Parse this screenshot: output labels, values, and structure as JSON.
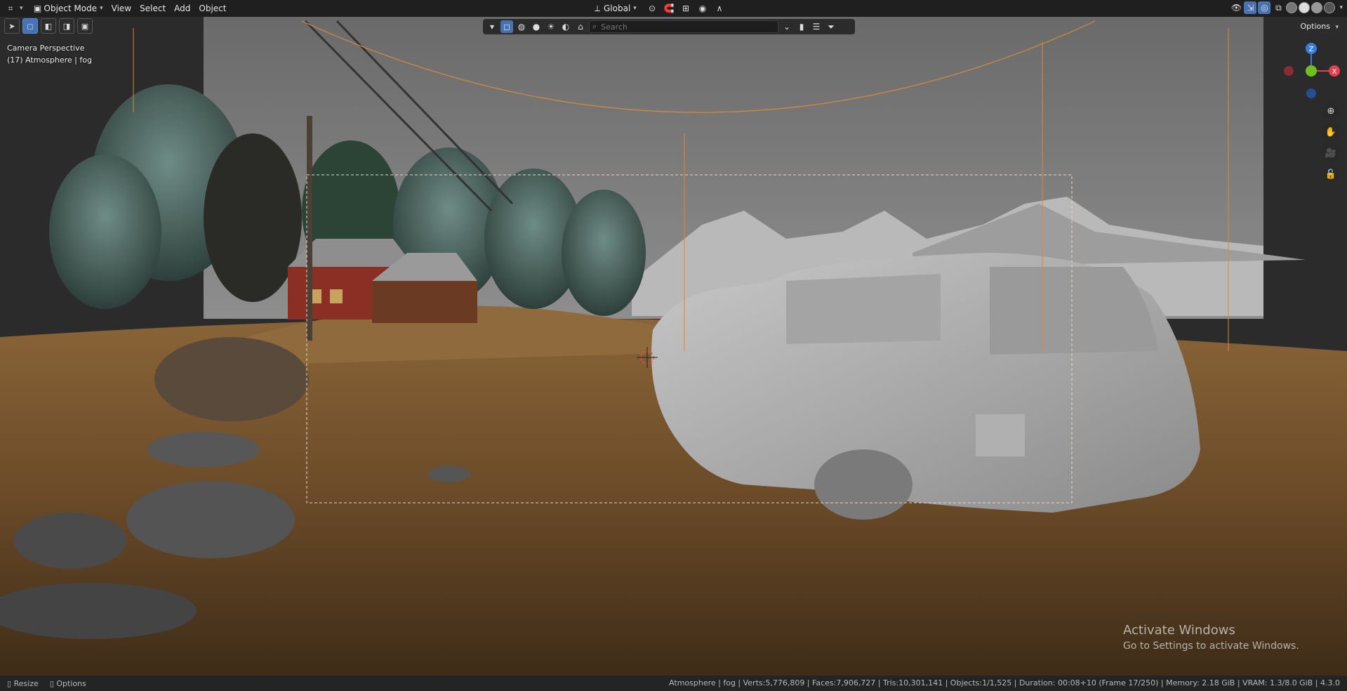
{
  "header": {
    "mode": "Object Mode",
    "menus": [
      "View",
      "Select",
      "Add",
      "Object"
    ],
    "transform_orientation": "Global"
  },
  "filter": {
    "search_placeholder": "Search"
  },
  "options_label": "Options",
  "overlay": {
    "perspective": "Camera Perspective",
    "object": "(17) Atmosphere | fog"
  },
  "gizmo": {
    "z": "Z",
    "x": "X",
    "colors": {
      "x": "#e0404f",
      "y": "#6fbf1f",
      "z": "#3a7be0"
    }
  },
  "watermark": {
    "title": "Activate Windows",
    "subtitle": "Go to Settings to activate Windows."
  },
  "status": {
    "left": [
      "Resize",
      "Options"
    ],
    "right": "Atmosphere | fog | Verts:5,776,809 | Faces:7,906,727 | Tris:10,301,141 | Objects:1/1,525 | Duration: 00:08+10 (Frame 17/250) | Memory: 2.18 GiB | VRAM: 1.3/8.0 GiB | 4.3.0"
  },
  "colors": {
    "accent": "#4772b3",
    "camera_outline": "#d98a3a",
    "ground": "#6a4a28"
  }
}
